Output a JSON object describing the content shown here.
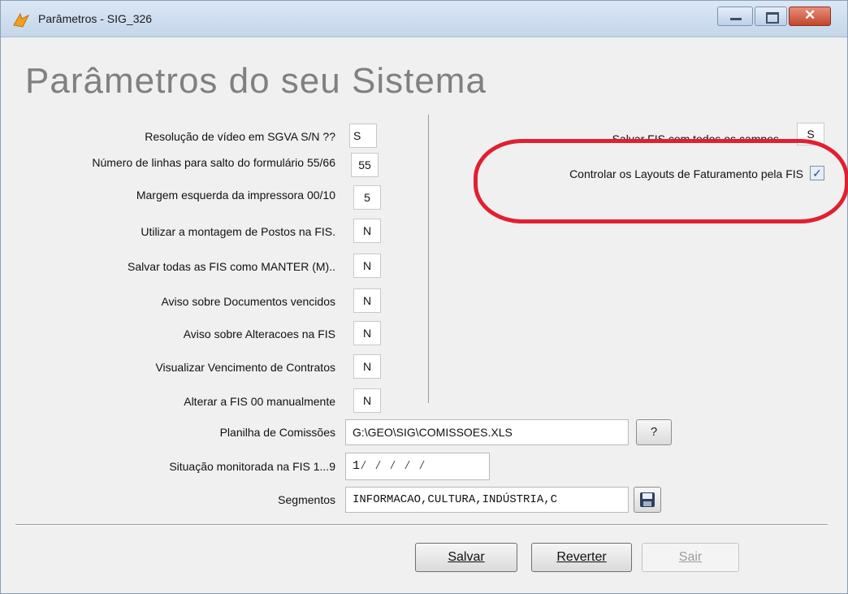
{
  "window": {
    "title": "Parâmetros - SIG_326",
    "close_glyph": "✕"
  },
  "page": {
    "title": "Parâmetros do seu Sistema"
  },
  "left_fields": [
    {
      "label": "Resolução de vídeo em SGVA S/N ??",
      "value": "S"
    },
    {
      "label": "Número de linhas para salto do formulário  55/66",
      "value": "55"
    },
    {
      "label": "Margem esquerda da impressora  00/10",
      "value": "5"
    },
    {
      "label": "Utilizar a montagem de Postos na FIS.",
      "value": "N"
    },
    {
      "label": "Salvar todas as FIS como MANTER (M)..",
      "value": "N"
    },
    {
      "label": "Aviso sobre Documentos vencidos",
      "value": "N"
    },
    {
      "label": "Aviso sobre Alteracoes na FIS",
      "value": "N"
    },
    {
      "label": "Visualizar Vencimento de Contratos",
      "value": "N"
    },
    {
      "label": "Alterar a FIS 00 manualmente",
      "value": "N"
    }
  ],
  "right_fields": {
    "save_all_label": "Salvar FIS com todos os campos",
    "save_all_value": "S",
    "layouts_label": "Controlar os Layouts de Faturamento pela FIS",
    "layouts_checked": "✓"
  },
  "planilha": {
    "label": "Planilha de Comissões",
    "value": "G:\\GEO\\SIG\\COMISSOES.XLS",
    "browse_label": "?"
  },
  "situacao": {
    "label": "Situação monitorada na FIS 1...9",
    "value": "1⁄  ⁄  ⁄  ⁄  ⁄"
  },
  "segmentos": {
    "label": "Segmentos",
    "value": "INFORMACAO,CULTURA,INDÚSTRIA,C"
  },
  "buttons": {
    "save": "Salvar",
    "revert": "Reverter",
    "exit": "Sair"
  },
  "colors": {
    "annotation_ellipse": "#e02030",
    "title_text": "#808080"
  }
}
